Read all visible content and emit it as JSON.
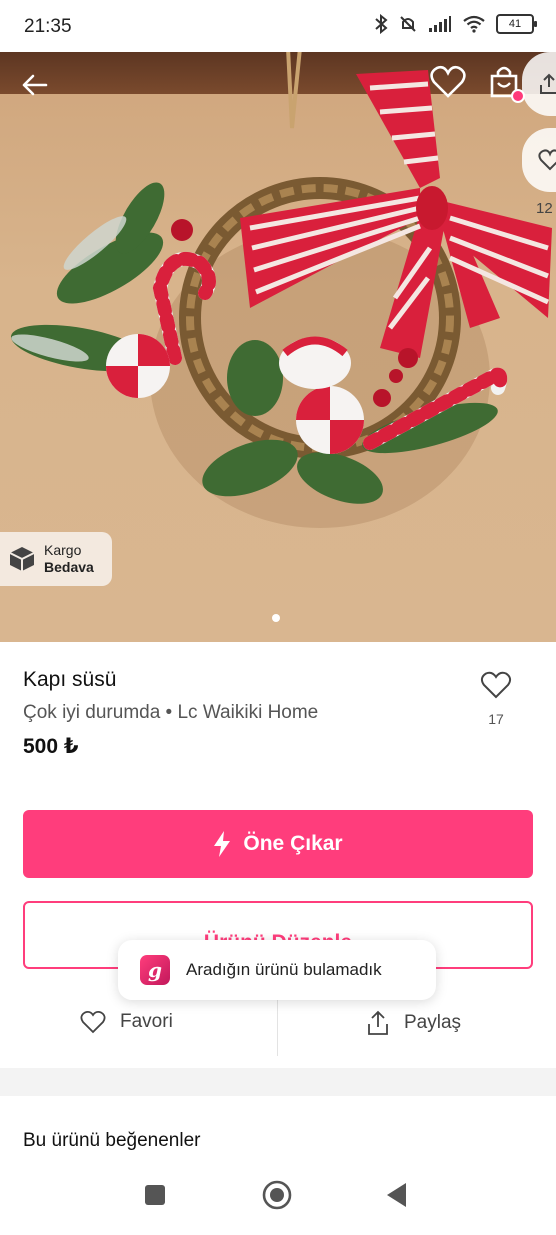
{
  "status_bar": {
    "time": "21:35",
    "battery": "41"
  },
  "hero": {
    "side_like_count": "12",
    "badge": {
      "line1": "Kargo",
      "line2": "Bedava"
    }
  },
  "product": {
    "title": "Kapı süsü",
    "subtitle": "Çok iyi durumda • Lc Waikiki Home",
    "price": "500 ₺",
    "like_count": "17"
  },
  "buttons": {
    "primary": "Öne Çıkar",
    "outline": "Ürünü Düzenle"
  },
  "toast": {
    "logo_letter": "g",
    "message": "Aradığın ürünü bulamadık"
  },
  "actions": {
    "favorite": "Favori",
    "share": "Paylaş"
  },
  "section": {
    "likers_title": "Bu ürünü beğenenler"
  },
  "colors": {
    "accent": "#ff3d7c",
    "text": "#111111",
    "muted": "#555555"
  },
  "icons": [
    "back-arrow-icon",
    "heart-icon",
    "shopping-bag-icon",
    "share-icon",
    "box-icon",
    "lightning-icon",
    "square-icon",
    "circle-home-icon",
    "triangle-back-icon"
  ]
}
